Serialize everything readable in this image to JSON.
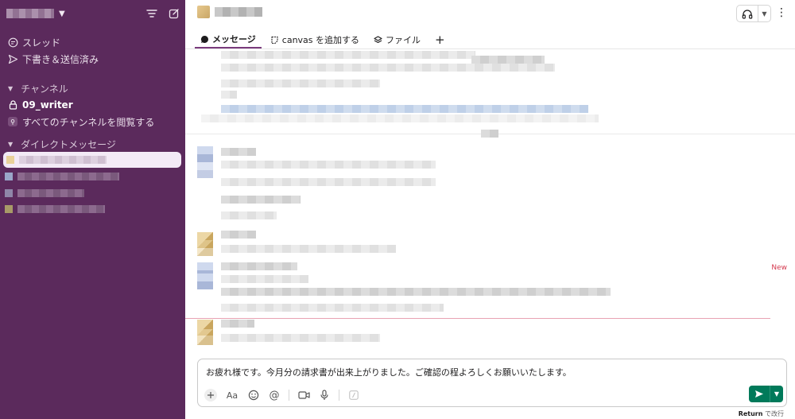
{
  "sidebar": {
    "nav": {
      "threads": "スレッド",
      "drafts": "下書き＆送信済み"
    },
    "channels_header": "チャンネル",
    "channel_name": "09_writer",
    "browse_channels": "すべてのチャンネルを閲覧する",
    "dm_header": "ダイレクトメッセージ"
  },
  "main": {
    "tabs": {
      "messages": "メッセージ",
      "canvas": "canvas を追加する",
      "files": "ファイル",
      "add": "+"
    },
    "new_label": "New",
    "composer": {
      "text": "お疲れ様です。今月分の請求書が出来上がりました。ご確認の程よろしくお願いいたします。",
      "format_label": "Aa"
    },
    "hint": {
      "key": "Return",
      "text": "で改行"
    }
  },
  "colors": {
    "sidebar_bg": "#5b2a5c",
    "active_tab": "#7a3b7c",
    "send_button": "#007a5a",
    "new_marker": "#d4394e"
  },
  "icons": [
    "filter-icon",
    "compose-icon",
    "threads-icon",
    "send-icon",
    "lock-icon",
    "search-icon",
    "headphones-icon",
    "kebab-icon",
    "message-icon",
    "canvas-icon",
    "layers-icon",
    "emoji-icon",
    "mention-icon",
    "video-icon",
    "mic-icon",
    "slash-icon"
  ]
}
